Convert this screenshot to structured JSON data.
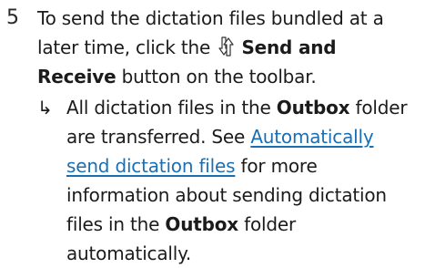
{
  "step": {
    "number": "5",
    "text_before": "To send the dictation files bundled at a later time, click the",
    "button_name": "Send and Receive",
    "text_after": "button on the toolbar.",
    "icon": "send-receive-icon"
  },
  "result": {
    "arrow": "↳",
    "text_before": "All dictation files in the",
    "folder": "Outbox",
    "text_middle": "folder are transferred. See",
    "link_text": "Automatically send dictation files",
    "text_after": "for more information about sending dictation files in the",
    "folder_again": "Outbox",
    "text_end": "folder automatically."
  },
  "colors": {
    "text": "#1b1b1b",
    "link": "#1a6fb4"
  }
}
